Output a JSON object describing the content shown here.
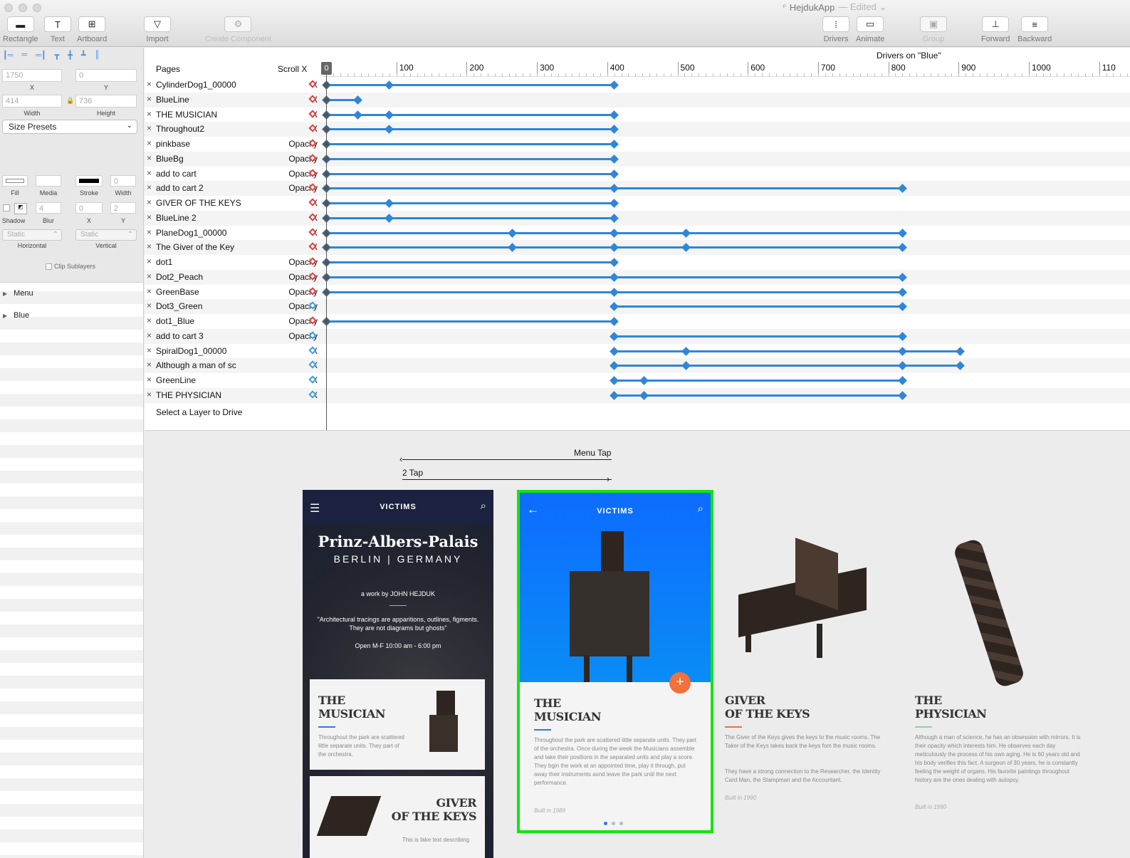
{
  "window": {
    "app_name": "HejdukApp",
    "edited": "— Edited ⌄"
  },
  "toolbar": {
    "left": [
      {
        "label": "Rectangle",
        "glyph": "▬"
      },
      {
        "label": "Text",
        "glyph": "T"
      },
      {
        "label": "Artboard",
        "glyph": "⊞"
      },
      {
        "label": "Import",
        "glyph": "▽"
      },
      {
        "label": "Create Component",
        "glyph": "⚙"
      }
    ],
    "right": [
      {
        "label": "Drivers",
        "glyph": "⁞"
      },
      {
        "label": "Animate",
        "glyph": "▭"
      },
      {
        "label": "Group",
        "glyph": "▣"
      },
      {
        "label": "Forward",
        "glyph": "⊥"
      },
      {
        "label": "Backward",
        "glyph": "≡"
      }
    ]
  },
  "inspector": {
    "x_value": "1750",
    "y_value": "0",
    "x_label": "X",
    "y_label": "Y",
    "width_value": "414",
    "height_value": "736",
    "width_label": "Width",
    "height_label": "Height",
    "size_presets": "Size Presets",
    "fill_label": "Fill",
    "media_label": "Media",
    "stroke_label": "Stroke",
    "stroke_width_label": "Width",
    "stroke_width_value": "0",
    "shadow_label": "Shadow",
    "blur_label": "Blur",
    "blur_value": "4",
    "shadow_x_value": "0",
    "shadow_y_value": "2",
    "sx_label": "X",
    "sy_label": "Y",
    "horizontal_value": "Static",
    "vertical_value": "Static",
    "horizontal_label": "Horizontal",
    "vertical_label": "Vertical",
    "clip_sublayers": "Clip Sublayers"
  },
  "layers": [
    {
      "name": "Menu"
    },
    {
      "name": "Blue"
    }
  ],
  "drivers": {
    "title": "Drivers on \"Blue\"",
    "col_pages": "Pages",
    "col_scroll": "Scroll X",
    "playhead": "0",
    "ruler_labels": [
      "100",
      "200",
      "300",
      "400",
      "500",
      "600",
      "700",
      "800",
      "900",
      "1000",
      "110"
    ],
    "select_hint": "Select a Layer to Drive",
    "rows": [
      {
        "name": "CylinderDog1_00000",
        "prop": "X",
        "kf": "red",
        "keys": [
          0,
          90,
          410
        ]
      },
      {
        "name": "BlueLine",
        "prop": "X",
        "kf": "red",
        "keys": [
          0,
          45
        ]
      },
      {
        "name": "THE MUSICIAN",
        "prop": "X",
        "kf": "red",
        "keys": [
          0,
          45,
          90,
          410
        ]
      },
      {
        "name": "Throughout2",
        "prop": "X",
        "kf": "red",
        "keys": [
          0,
          90,
          410
        ]
      },
      {
        "name": "pinkbase",
        "prop": "Opacity",
        "kf": "red",
        "keys": [
          0,
          410
        ]
      },
      {
        "name": "BlueBg",
        "prop": "Opacity",
        "kf": "red",
        "keys": [
          0,
          410
        ]
      },
      {
        "name": "add to cart",
        "prop": "Opacity",
        "kf": "red",
        "keys": [
          0,
          410
        ]
      },
      {
        "name": "add to cart 2",
        "prop": "Opacity",
        "kf": "red",
        "keys": [
          0,
          410,
          820
        ]
      },
      {
        "name": "GIVER OF THE KEYS",
        "prop": "X",
        "kf": "red",
        "keys": [
          0,
          90,
          410
        ]
      },
      {
        "name": "BlueLine 2",
        "prop": "X",
        "kf": "red",
        "keys": [
          0,
          90,
          410
        ]
      },
      {
        "name": "PlaneDog1_00000",
        "prop": "X",
        "kf": "red",
        "keys": [
          0,
          265,
          410,
          512,
          820
        ]
      },
      {
        "name": "The Giver of the Key",
        "prop": "X",
        "kf": "red",
        "keys": [
          0,
          265,
          410,
          512,
          820
        ]
      },
      {
        "name": "dot1",
        "prop": "Opacity",
        "kf": "red",
        "keys": [
          0,
          410
        ]
      },
      {
        "name": "Dot2_Peach",
        "prop": "Opacity",
        "kf": "red",
        "keys": [
          0,
          410,
          820
        ]
      },
      {
        "name": "GreenBase",
        "prop": "Opacity",
        "kf": "red",
        "keys": [
          0,
          410,
          820
        ]
      },
      {
        "name": "Dot3_Green",
        "prop": "Opacity",
        "kf": "blue",
        "keys": [
          410,
          820
        ]
      },
      {
        "name": "dot1_Blue",
        "prop": "Opacity",
        "kf": "red",
        "keys": [
          0,
          410
        ]
      },
      {
        "name": "add to cart 3",
        "prop": "Opacity",
        "kf": "blue",
        "keys": [
          410,
          820
        ]
      },
      {
        "name": "SpiralDog1_00000",
        "prop": "X",
        "kf": "blue",
        "keys": [
          410,
          512,
          820,
          902
        ]
      },
      {
        "name": "Although a man of sc",
        "prop": "X",
        "kf": "blue",
        "keys": [
          410,
          512,
          820,
          902
        ]
      },
      {
        "name": "GreenLine",
        "prop": "X",
        "kf": "blue",
        "keys": [
          410,
          452,
          820
        ]
      },
      {
        "name": "THE PHYSICIAN",
        "prop": "X",
        "kf": "blue",
        "keys": [
          410,
          452,
          820
        ]
      }
    ]
  },
  "canvas": {
    "menu_tap": "Menu Tap",
    "two_tap": "2 Tap",
    "artboard1": {
      "nav_title": "VICTIMS",
      "place": "Prinz-Albers-Palais",
      "city": "BERLIN | GERMANY",
      "work_by": "a work by JOHN HEJDUK",
      "quote": "\"Architectural tracings are apparitions, outlines, figments. They are not diagrams but ghosts\"",
      "hours": "Open M-F 10:00 am - 6:00 pm",
      "card1_title_1": "THE",
      "card1_title_2": "MUSICIAN",
      "card1_body": "Throughout the park are scattered little separate units. They part of the orchestra.",
      "card2_title_1": "GIVER",
      "card2_title_2": "OF THE KEYS",
      "card2_body": "This is fake text describing"
    },
    "artboard2": {
      "nav_title": "VICTIMS",
      "title_1": "THE",
      "title_2": "MUSICIAN",
      "body": "Throughout the park are scattered little separate units. They part of the orchestra. Once during the week the Musicians assemble and take their positions in the separated units and play a score. They bgin the work at an appointed time, play it through, put away their instruments asnd leave the park until the next performance.",
      "built": "Built in 1989",
      "fab": "+",
      "accent": "#0d6cff"
    },
    "panel3": {
      "title_1": "GIVER",
      "title_2": "OF THE KEYS",
      "body1": "The Giver of the Keys gives the keys to the music rooms. The Taker of the Keys takes back the keys fom the music rooms.",
      "body2": "They have a strong connection to the Researcher, the Identity Card Man, the Stampman and the Accountant.",
      "built": "Built in 1990",
      "accent": "#f2703a"
    },
    "panel4": {
      "title_1": "THE",
      "title_2": "PHYSICIAN",
      "body": "Although a man of science, he has an obsession with mirrors. It is their opacity which interests him. He observes each day meticulously the process of his own aging. He is 60 years old and his body verifies this fact. A surgeon of 30 years, he is constantly feeling the weight of organs. His favorite paintings throughout history are the ones dealing with autopsy.",
      "built": "Built in 1990",
      "accent": "#8fd0b0"
    }
  }
}
